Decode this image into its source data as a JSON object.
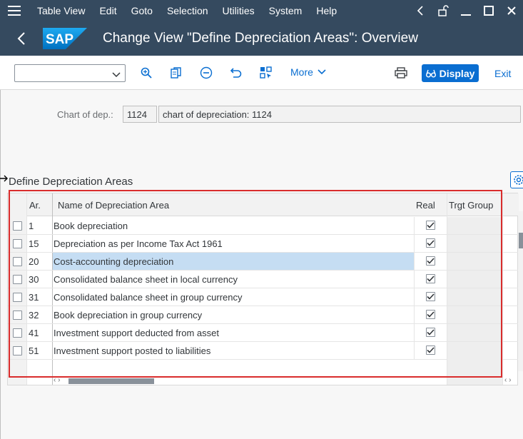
{
  "menubar": {
    "items": [
      "Table View",
      "Edit",
      "Goto",
      "Selection",
      "Utilities",
      "System",
      "Help"
    ]
  },
  "titlebar": {
    "title": "Change View \"Define Depreciation Areas\": Overview",
    "logo_text": "SAP"
  },
  "toolbar": {
    "command_field_value": "",
    "more_label": "More",
    "display_label": "Display",
    "exit_label": "Exit"
  },
  "header_fields": {
    "chart_label": "Chart of dep.:",
    "chart_code": "1124",
    "chart_desc": "chart of depreciation: 1124"
  },
  "section": {
    "title": "Define Depreciation Areas"
  },
  "table": {
    "columns": {
      "ar": "Ar.",
      "name": "Name of Depreciation Area",
      "real": "Real",
      "trgt": "Trgt Group"
    },
    "rows": [
      {
        "ar": "1",
        "name": "Book depreciation",
        "real": true,
        "selected": false
      },
      {
        "ar": "15",
        "name": "Depreciation as per Income Tax  Act 1961",
        "real": true,
        "selected": false
      },
      {
        "ar": "20",
        "name": "Cost-accounting depreciation",
        "real": true,
        "selected": true
      },
      {
        "ar": "30",
        "name": "Consolidated balance sheet in local currency",
        "real": true,
        "selected": false
      },
      {
        "ar": "31",
        "name": "Consolidated balance sheet in group currency",
        "real": true,
        "selected": false
      },
      {
        "ar": "32",
        "name": "Book depreciation in group currency",
        "real": true,
        "selected": false
      },
      {
        "ar": "41",
        "name": "Investment support deducted from asset",
        "real": true,
        "selected": false
      },
      {
        "ar": "51",
        "name": "Investment support posted to liabilities",
        "real": true,
        "selected": false
      }
    ]
  },
  "colors": {
    "shell": "#354a5f",
    "accent": "#0a6ed1",
    "selection": "#c5ddf3",
    "highlight_frame": "#d92c2c"
  }
}
